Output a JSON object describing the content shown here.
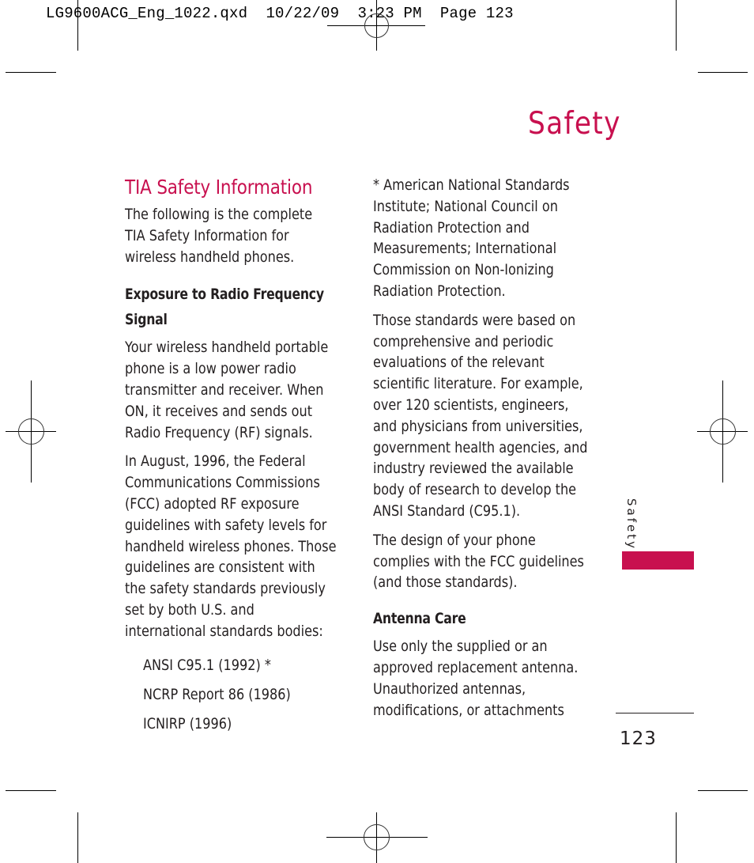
{
  "slug_line": "LG9600ACG_Eng_1022.qxd  10/22/09  3:23 PM  Page 123",
  "chapter_title": "Safety",
  "left_column": {
    "heading": "TIA Safety Information",
    "intro": "The following is the complete\nTIA Safety Information for\nwireless handheld phones.",
    "subheading": "Exposure to Radio Frequency\nSignal",
    "paragraphs": [
      "Your wireless handheld portable\nphone is a low power radio\ntransmitter and receiver. When\nON, it receives and sends out\nRadio Frequency (RF) signals.",
      "In August, 1996, the Federal\nCommunications Commissions\n(FCC) adopted RF exposure\nguidelines with safety levels for\nhandheld wireless phones. Those\nguidelines are consistent with\nthe safety standards previously\nset by both U.S. and\ninternational standards bodies:"
    ],
    "standards": [
      "ANSI C95.1  (1992) *",
      "NCRP Report 86 (1986)",
      "ICNIRP (1996)"
    ]
  },
  "right_column": {
    "footnote": "* American National Standards\nInstitute; National Council on\nRadiation Protection and\nMeasurements; International\nCommission on Non-Ionizing\nRadiation Protection.",
    "paragraphs": [
      "Those standards were based on\ncomprehensive and periodic\nevaluations of the relevant\nscientific literature. For example,\nover 120 scientists, engineers,\nand physicians from universities,\ngovernment health agencies, and\nindustry reviewed the available\nbody of research to develop the\nANSI Standard (C95.1).",
      "The design of your phone\ncomplies with the FCC guidelines\n(and those standards)."
    ],
    "subheading": "Antenna Care",
    "antenna_text": "Use only the supplied or an\napproved replacement antenna.\nUnauthorized antennas,\nmodifications, or attachments"
  },
  "side_tab": {
    "label": "Safety",
    "color": "#c8104f"
  },
  "page_number": "123",
  "accent_color": "#c8104f"
}
